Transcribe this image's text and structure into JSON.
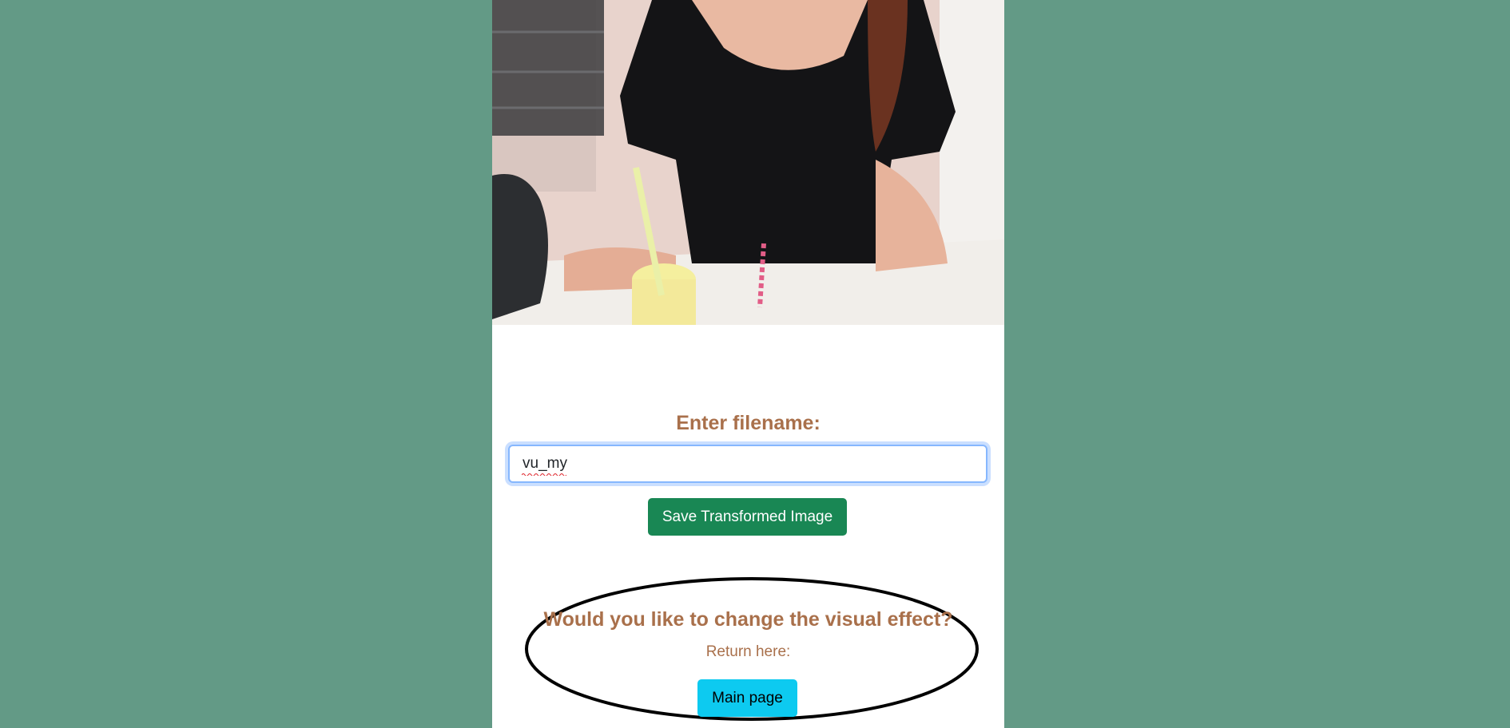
{
  "form": {
    "label": "Enter filename:",
    "filename_value": "vu_my",
    "save_button_label": "Save Transformed Image"
  },
  "navigation": {
    "question": "Would you like to change the visual effect?",
    "return_text": "Return here:",
    "main_page_button_label": "Main page"
  },
  "colors": {
    "page_background": "#639a86",
    "heading_text": "#a9704b",
    "save_button": "#198754",
    "main_page_button": "#0dcaf0"
  }
}
